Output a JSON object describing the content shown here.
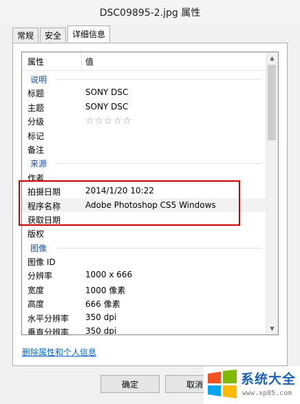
{
  "window": {
    "title": "DSC09895-2.jpg 属性"
  },
  "tabs": [
    {
      "label": "常规"
    },
    {
      "label": "安全"
    },
    {
      "label": "详细信息",
      "active": true
    }
  ],
  "list": {
    "header": {
      "property": "属性",
      "value": "值"
    },
    "rows": [
      {
        "type": "group",
        "label": "说明"
      },
      {
        "label": "标题",
        "value": "SONY DSC"
      },
      {
        "label": "主题",
        "value": "SONY DSC"
      },
      {
        "label": "分级",
        "value": "☆☆☆☆☆",
        "stars": true
      },
      {
        "label": "标记",
        "value": ""
      },
      {
        "label": "备注",
        "value": ""
      },
      {
        "type": "group",
        "label": "来源"
      },
      {
        "label": "作者",
        "value": ""
      },
      {
        "label": "拍摄日期",
        "value": "2014/1/20 10:22"
      },
      {
        "label": "程序名称",
        "value": "Adobe Photoshop CS5 Windows",
        "selected": true
      },
      {
        "label": "获取日期",
        "value": ""
      },
      {
        "label": "版权",
        "value": ""
      },
      {
        "type": "group",
        "label": "图像"
      },
      {
        "label": "图像 ID",
        "value": ""
      },
      {
        "label": "分辨率",
        "value": "1000 x 666"
      },
      {
        "label": "宽度",
        "value": "1000 像素"
      },
      {
        "label": "高度",
        "value": "666 像素"
      },
      {
        "label": "水平分辨率",
        "value": "350 dpi"
      },
      {
        "label": "垂直分辨率",
        "value": "350 dpi"
      }
    ]
  },
  "footer": {
    "link": "删除属性和个人信息",
    "ok": "确定",
    "cancel": "取消"
  },
  "watermark": {
    "title": "系统大全",
    "url": "www.xp85.com"
  },
  "colors": {
    "highlight_box": "#cc0000",
    "group": "#1e4ea3",
    "link": "#0066cc"
  }
}
